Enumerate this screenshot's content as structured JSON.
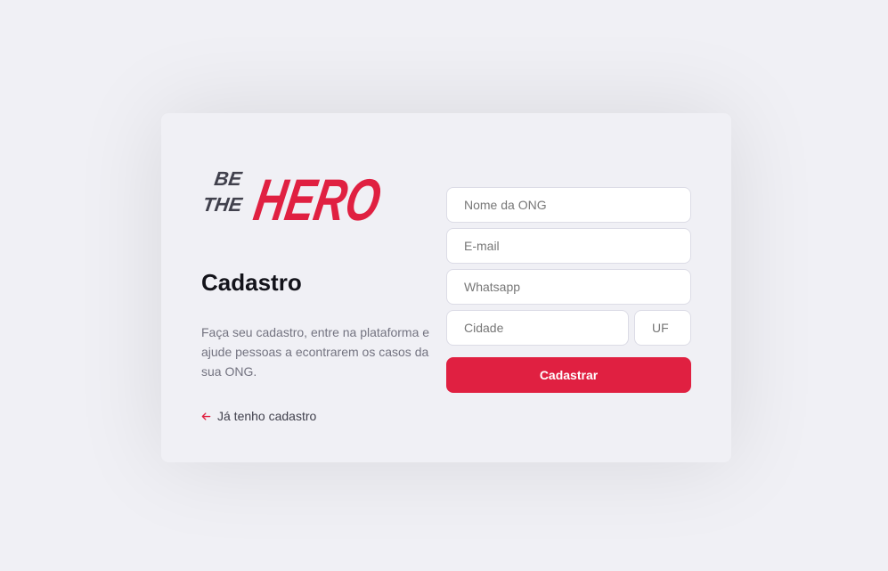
{
  "logo": {
    "small_text_1": "BE",
    "small_text_2": "THE",
    "big_text": "HERO",
    "colors": {
      "dark": "#41414d",
      "accent": "#e02041"
    }
  },
  "page": {
    "title": "Cadastro",
    "description": "Faça seu cadastro, entre na plataforma e ajude pessoas a econtrarem os casos da sua ONG.",
    "back_link_label": "Já tenho cadastro",
    "back_link_icon": "arrow-left-icon"
  },
  "form": {
    "name_placeholder": "Nome da ONG",
    "email_placeholder": "E-mail",
    "whatsapp_placeholder": "Whatsapp",
    "city_placeholder": "Cidade",
    "uf_placeholder": "UF",
    "submit_label": "Cadastrar"
  },
  "colors": {
    "background": "#f0f0f5",
    "accent": "#e02041",
    "text_dark": "#13131a",
    "text_muted": "#737380",
    "input_border": "#dcdce6"
  }
}
